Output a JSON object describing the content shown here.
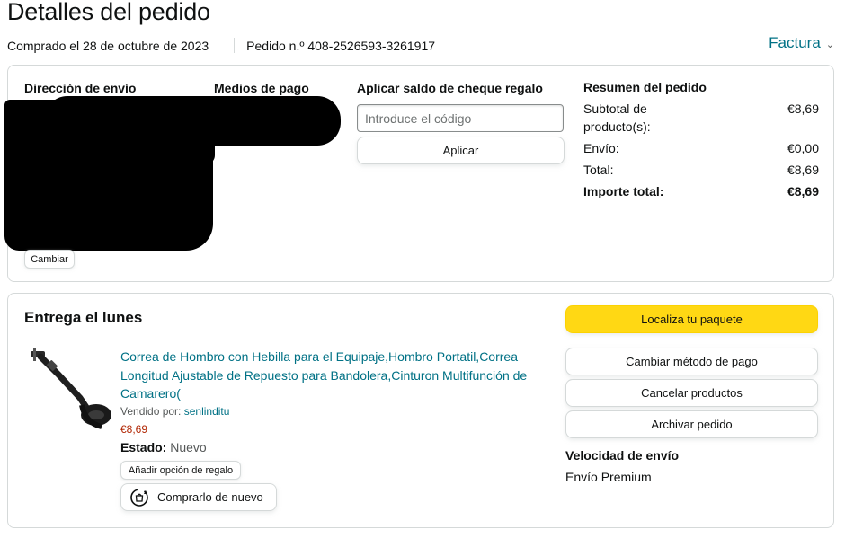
{
  "header": {
    "title": "Detalles del pedido",
    "ordered_on": "Comprado el 28 de octubre de 2023",
    "order_number": "Pedido n.º 408-2526593-3261917",
    "invoice_label": "Factura"
  },
  "order_info": {
    "shipping_heading": "Dirección de envío",
    "payment_heading": "Medios de pago",
    "change_label": "Cambiar",
    "gift_heading": "Aplicar saldo de cheque regalo",
    "gift_placeholder": "Introduce el código",
    "apply_label": "Aplicar"
  },
  "summary": {
    "heading": "Resumen del pedido",
    "rows": [
      {
        "label": "Subtotal de producto(s):",
        "value": "€8,69"
      },
      {
        "label": "Envío:",
        "value": "€0,00"
      },
      {
        "label": "Total:",
        "value": "€8,69"
      },
      {
        "label": "Importe total:",
        "value": "€8,69"
      }
    ]
  },
  "delivery": {
    "title": "Entrega el lunes",
    "product": {
      "title": "Correa de Hombro con Hebilla para el Equipaje,Hombro Portatil,Correa Longitud Ajustable de Repuesto para Bandolera,Cinturon Multifunción de Camarero(",
      "sold_by_label": "Vendido por:",
      "seller": "senlinditu",
      "price": "€8,69",
      "condition_label": "Estado:",
      "condition": "Nuevo",
      "gift_option_label": "Añadir opción de regalo",
      "buy_again_label": "Comprarlo de nuevo"
    },
    "actions": {
      "track": "Localiza tu paquete",
      "change_payment": "Cambiar método de pago",
      "cancel": "Cancelar productos",
      "archive": "Archivar pedido"
    },
    "speed_heading": "Velocidad de envío",
    "speed_value": "Envío Premium"
  },
  "colors": {
    "link": "#007185",
    "price": "#b12704",
    "primary_button": "#ffd814",
    "border": "#d5d9d9"
  }
}
